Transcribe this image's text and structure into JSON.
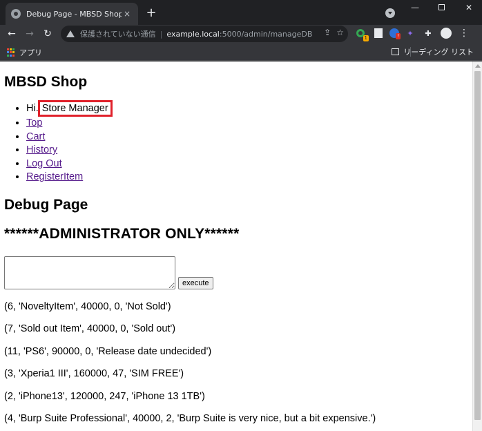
{
  "browser": {
    "tab_title": "Debug Page - MBSD Shop",
    "tab_close": "×",
    "new_tab": "+",
    "win_min": "—",
    "win_close": "✕",
    "nav_back": "←",
    "nav_forward": "→",
    "nav_reload": "↻",
    "security_label": "保護されていない通信",
    "url_separator": "|",
    "url_host": "example.local",
    "url_path": ":5000/admin/manageDB",
    "share_icon": "⇪",
    "star_icon": "☆",
    "ext_badge_1": "1",
    "ext_badge_2": "!",
    "ext_purple_glyph": "✦",
    "menu_glyph": "⋮",
    "puzzle_glyph": "✚",
    "bookmarks": {
      "apps_label": "アプリ",
      "reading_list_label": "リーディング リスト"
    }
  },
  "page": {
    "site_title": "MBSD Shop",
    "greeting_prefix": "Hi.",
    "user_name": "Store Manager",
    "nav_links": [
      "Top",
      "Cart",
      "History",
      "Log Out",
      "RegisterItem"
    ],
    "heading": "Debug Page",
    "admin_notice": "******ADMINISTRATOR ONLY******",
    "query_value": "",
    "execute_label": "execute",
    "results": [
      "(6, 'NoveltyItem', 40000, 0, 'Not Sold')",
      "(7, 'Sold out Item', 40000, 0, 'Sold out')",
      "(11, 'PS6', 90000, 0, 'Release date undecided')",
      "(3, 'Xperia1 III', 160000, 47, 'SIM FREE')",
      "(2, 'iPhone13', 120000, 247, 'iPhone 13 1TB')",
      "(4, 'Burp Suite Professional', 40000, 2, 'Burp Suite is very nice, but a bit expensive.')"
    ]
  },
  "colors": {
    "highlight_box": "#e0202a",
    "visited_link": "#551a8b",
    "chrome_dark": "#202124",
    "chrome_toolbar": "#35363a"
  }
}
